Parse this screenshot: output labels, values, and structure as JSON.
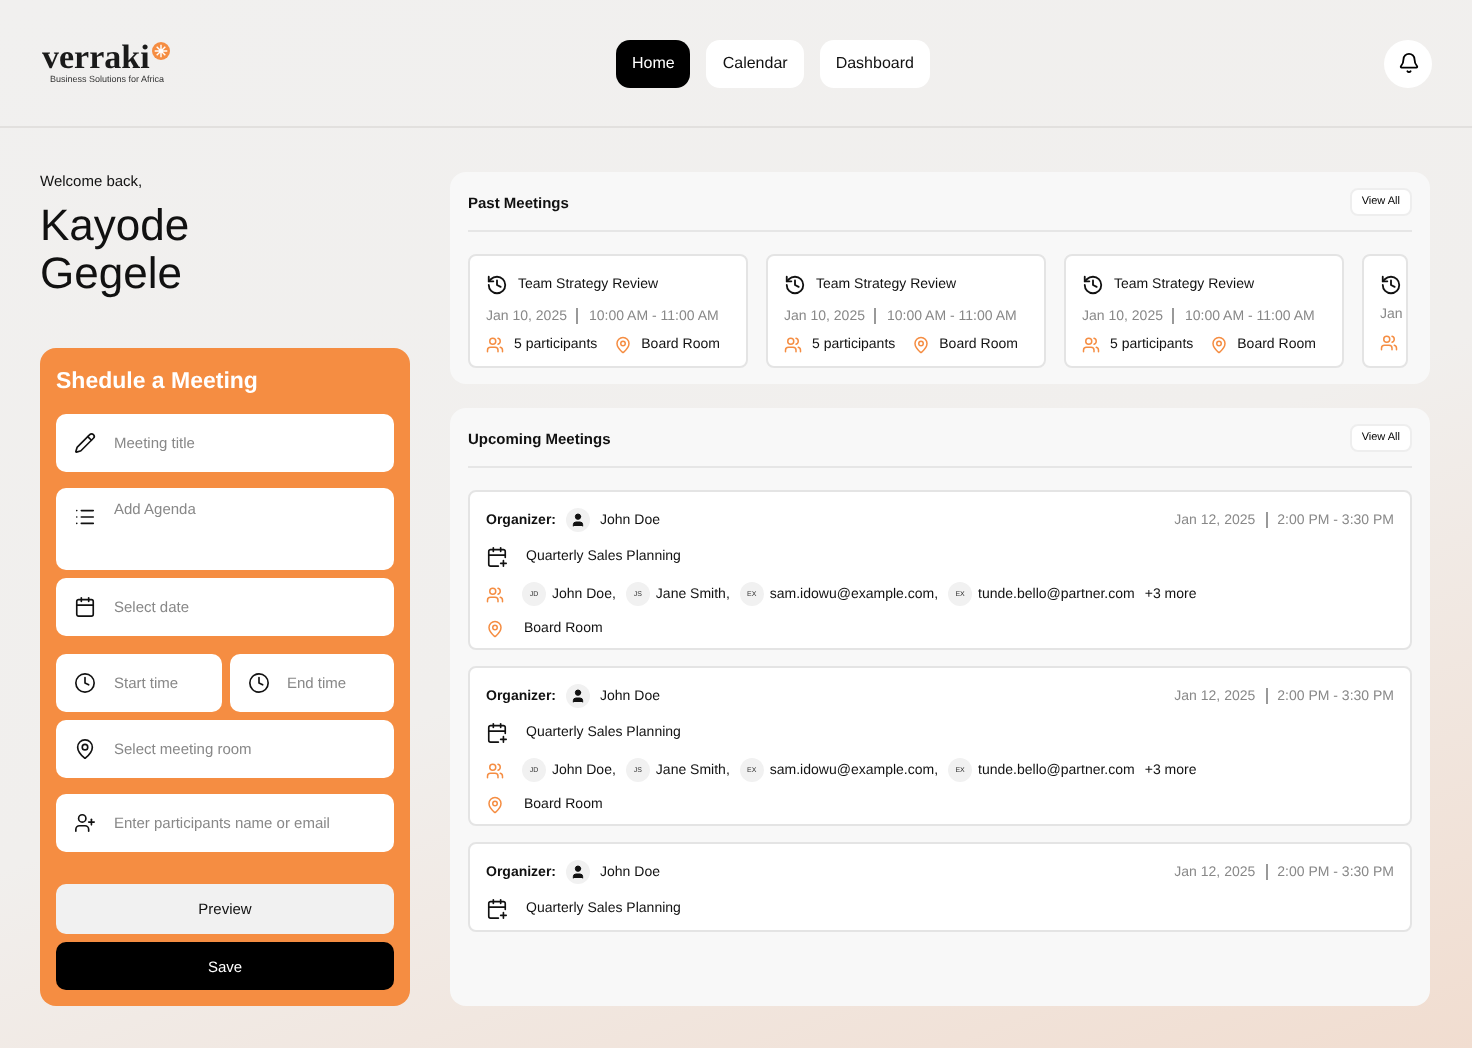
{
  "logo": {
    "name": "verraki",
    "tagline": "Business Solutions for Africa"
  },
  "nav": [
    {
      "label": "Home",
      "selected": true
    },
    {
      "label": "Calendar",
      "selected": false
    },
    {
      "label": "Dashboard",
      "selected": false
    }
  ],
  "welcome": {
    "greeting": "Welcome back,",
    "name_first": "Kayode",
    "name_last": "Gegele"
  },
  "schedule_form": {
    "title": "Shedule a Meeting",
    "fields": [
      {
        "kind": "title",
        "placeholder": "Meeting title"
      },
      {
        "kind": "agenda",
        "placeholder": "Add Agenda"
      },
      {
        "kind": "date",
        "placeholder": "Select date"
      },
      {
        "kind": "start",
        "placeholder": "Start time"
      },
      {
        "kind": "end",
        "placeholder": "End time"
      },
      {
        "kind": "room",
        "placeholder": "Select meeting room"
      },
      {
        "kind": "participants",
        "placeholder": "Enter participants name or email"
      }
    ],
    "buttons": [
      {
        "kind": "secondary",
        "label": "Preview"
      },
      {
        "kind": "primary",
        "label": "Save"
      }
    ]
  },
  "past_meetings": {
    "title": "Past Meetings",
    "action": "View All",
    "items": [
      {
        "title": "Team Strategy Review",
        "date": "Jan 10, 2025",
        "time": "10:00 AM - 11:00 AM",
        "participants": "5 participants",
        "room": "Board Room"
      },
      {
        "title": "Team Strategy Review",
        "date": "Jan 10, 2025",
        "time": "10:00 AM - 11:00 AM",
        "participants": "5 participants",
        "room": "Board Room"
      },
      {
        "title": "Team Strategy Review",
        "date": "Jan 10, 2025",
        "time": "10:00 AM - 11:00 AM",
        "participants": "5 participants",
        "room": "Board Room"
      },
      {
        "date": "Jan"
      }
    ]
  },
  "upcoming_meetings": {
    "title": "Upcoming Meetings",
    "action": "View All",
    "items": [
      {
        "organizer_label": "Organizer:",
        "organizer": "John Doe",
        "date": "Jan 12, 2025",
        "time": "2:00 PM - 3:30 PM",
        "title": "Quarterly Sales Planning",
        "attendees": [
          {
            "initials": "JD",
            "name": "John Doe,"
          },
          {
            "initials": "JS",
            "name": "Jane Smith,"
          },
          {
            "initials": "EX",
            "name": "sam.idowu@example.com,"
          },
          {
            "initials": "EX",
            "name": "tunde.bello@partner.com"
          }
        ],
        "more": "+3 more",
        "room": "Board Room"
      },
      {
        "organizer_label": "Organizer:",
        "organizer": "John Doe",
        "date": "Jan 12, 2025",
        "time": "2:00 PM - 3:30 PM",
        "title": "Quarterly Sales Planning",
        "attendees": [
          {
            "initials": "JD",
            "name": "John Doe,"
          },
          {
            "initials": "JS",
            "name": "Jane Smith,"
          },
          {
            "initials": "EX",
            "name": "sam.idowu@example.com,"
          },
          {
            "initials": "EX",
            "name": "tunde.bello@partner.com"
          }
        ],
        "more": "+3 more",
        "room": "Board Room"
      },
      {
        "organizer_label": "Organizer:",
        "organizer": "John Doe",
        "date": "Jan 12, 2025",
        "time": "2:00 PM - 3:30 PM",
        "title": "Quarterly Sales Planning"
      }
    ]
  }
}
